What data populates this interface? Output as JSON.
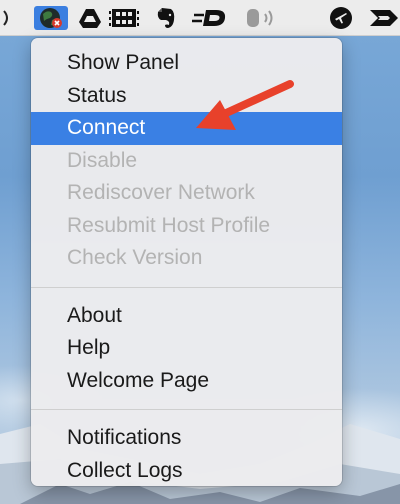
{
  "menubar": {
    "icons": [
      {
        "name": "partial-icon",
        "glyph": ")"
      },
      {
        "name": "globe-network-icon",
        "glyph": ""
      },
      {
        "name": "google-drive-icon",
        "glyph": ""
      },
      {
        "name": "film-grid-icon",
        "glyph": ""
      },
      {
        "name": "evernote-elephant-icon",
        "glyph": ""
      },
      {
        "name": "dropzone-d-icon",
        "glyph": "D"
      },
      {
        "name": "volume-icon",
        "glyph": ""
      },
      {
        "name": "airplane-circle-icon",
        "glyph": ""
      },
      {
        "name": "arrow-chevron-icon",
        "glyph": ""
      }
    ]
  },
  "menu": {
    "group1": [
      {
        "label": "Show Panel",
        "state": "enabled"
      },
      {
        "label": "Status",
        "state": "enabled"
      },
      {
        "label": "Connect",
        "state": "highlighted"
      },
      {
        "label": "Disable",
        "state": "disabled"
      },
      {
        "label": "Rediscover Network",
        "state": "disabled"
      },
      {
        "label": "Resubmit Host Profile",
        "state": "disabled"
      },
      {
        "label": "Check Version",
        "state": "disabled"
      }
    ],
    "group2": [
      {
        "label": "About",
        "state": "enabled"
      },
      {
        "label": "Help",
        "state": "enabled"
      },
      {
        "label": "Welcome Page",
        "state": "enabled"
      }
    ],
    "group3": [
      {
        "label": "Notifications",
        "state": "enabled"
      },
      {
        "label": "Collect Logs",
        "state": "enabled"
      }
    ]
  },
  "colors": {
    "highlight": "#3a80e4",
    "arrow": "#e8412b",
    "disabled_text": "#b3b3b3"
  }
}
